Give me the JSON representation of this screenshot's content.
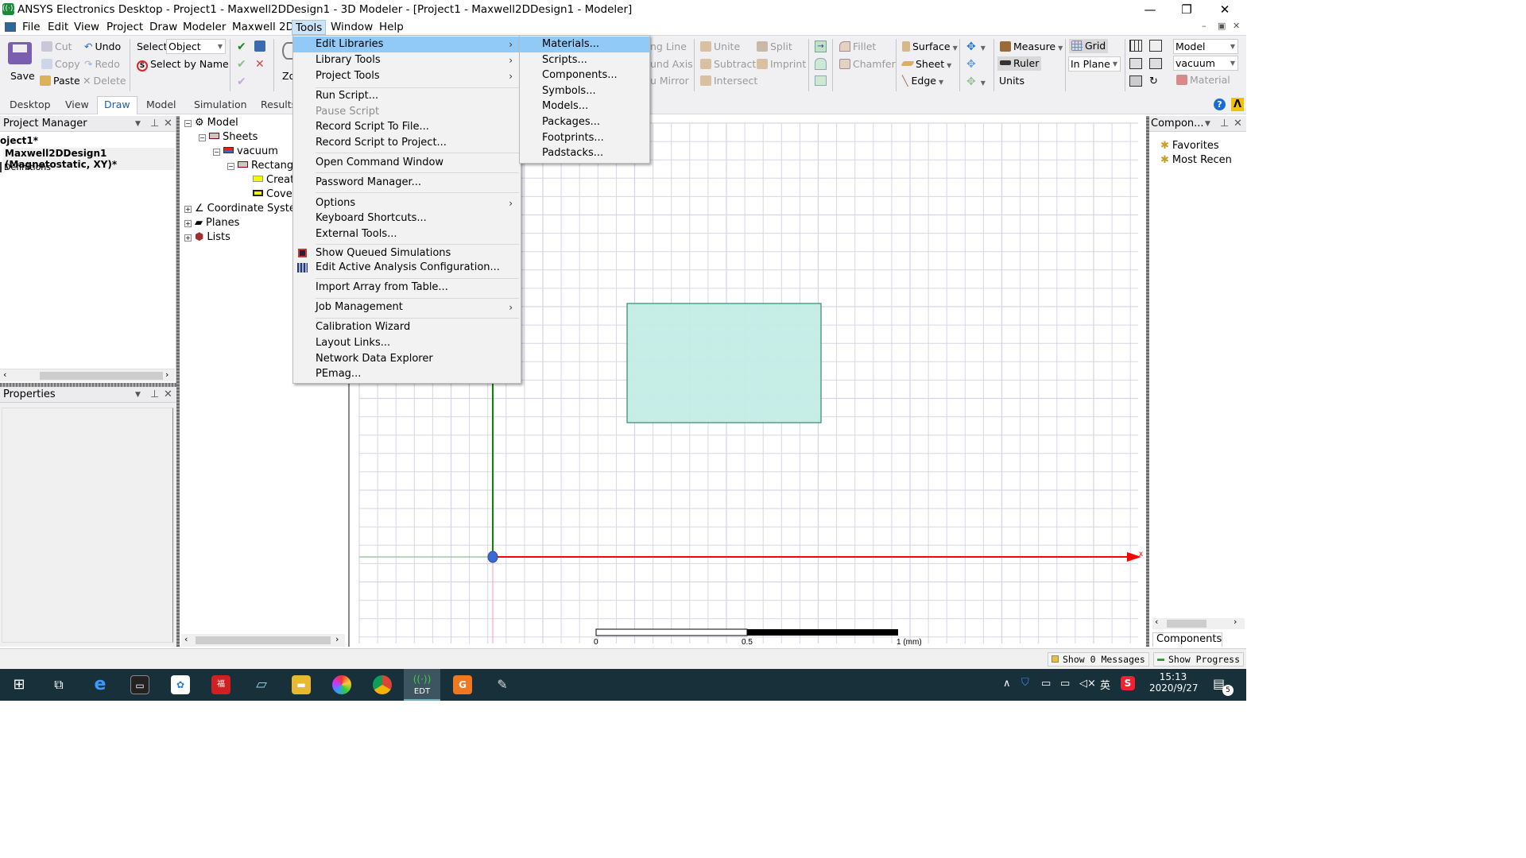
{
  "window": {
    "title": "ANSYS Electronics Desktop - Project1 - Maxwell2DDesign1 - 3D Modeler - [Project1 - Maxwell2DDesign1 - Modeler]",
    "controls": {
      "minimize": "—",
      "restore": "❐",
      "close": "✕"
    },
    "mdi_controls": {
      "minimize": "–",
      "restore": "▣",
      "close": "✕"
    }
  },
  "menubar": {
    "items": [
      "File",
      "Edit",
      "View",
      "Project",
      "Draw",
      "Modeler",
      "Maxwell 2D",
      "Tools",
      "Window",
      "Help"
    ],
    "active": "Tools"
  },
  "ribbon": {
    "save": "Save",
    "cut": "Cut",
    "copy": "Copy",
    "paste": "Paste",
    "undo": "Undo",
    "redo": "Redo",
    "delete": "Delete",
    "select_label": "Select:",
    "select_value": "Object",
    "select_by_name": "Select by Name",
    "zoom_partial": "Zo",
    "along_line": "ng Line",
    "around_axis": "und Axis",
    "thru_mirror": "u Mirror",
    "unite": "Unite",
    "subtract": "Subtract",
    "intersect": "Intersect",
    "split": "Split",
    "imprint": "Imprint",
    "fillet": "Fillet",
    "chamfer": "Chamfer",
    "surface": "Surface",
    "sheet": "Sheet",
    "edge": "Edge",
    "measure": "Measure",
    "ruler": "Ruler",
    "units": "Units",
    "grid": "Grid",
    "grid_plane": "In Plane",
    "model_select": "Model",
    "material_select": "vacuum",
    "material_button": "Material"
  },
  "ribbon_tabs": {
    "items": [
      "Desktop",
      "View",
      "Draw",
      "Model",
      "Simulation",
      "Results"
    ],
    "active": "Draw"
  },
  "project_manager": {
    "title": "Project Manager",
    "project": "oject1*",
    "design": "Maxwell2DDesign1 (Magnetostatic, XY)*",
    "definitions": "Definitions"
  },
  "properties": {
    "title": "Properties"
  },
  "model_tree": {
    "items": [
      {
        "label": "Model",
        "expander": "⊟"
      },
      {
        "label": "Sheets",
        "expander": "⊟"
      },
      {
        "label": "vacuum",
        "expander": "⊟"
      },
      {
        "label": "Rectang",
        "expander": "⊟"
      },
      {
        "label": "Creat",
        "expander": ""
      },
      {
        "label": "Cove",
        "expander": ""
      },
      {
        "label": "Coordinate Syste",
        "expander": "⊞"
      },
      {
        "label": "Planes",
        "expander": "⊞"
      },
      {
        "label": "Lists",
        "expander": "⊞"
      }
    ]
  },
  "tools_menu": {
    "items": [
      {
        "label": "Edit Libraries",
        "submenu": true,
        "highlighted": true
      },
      {
        "label": "Library Tools",
        "submenu": true
      },
      {
        "label": "Project Tools",
        "submenu": true
      },
      {
        "label": "Run Script..."
      },
      {
        "label": "Pause Script",
        "disabled": true
      },
      {
        "label": "Record Script To File..."
      },
      {
        "label": "Record Script to Project..."
      },
      {
        "label": "Open Command Window"
      },
      {
        "label": "Password Manager..."
      },
      {
        "label": "Options",
        "submenu": true
      },
      {
        "label": "Keyboard Shortcuts..."
      },
      {
        "label": "External Tools..."
      },
      {
        "label": "Show Queued Simulations"
      },
      {
        "label": "Edit Active Analysis Configuration..."
      },
      {
        "label": "Import Array from Table..."
      },
      {
        "label": "Job Management",
        "submenu": true
      },
      {
        "label": "Calibration Wizard"
      },
      {
        "label": "Layout Links..."
      },
      {
        "label": "Network Data Explorer"
      },
      {
        "label": "PEmag..."
      }
    ],
    "submenu_arrow": "›"
  },
  "edit_libraries_submenu": {
    "items": [
      "Materials...",
      "Scripts...",
      "Components...",
      "Symbols...",
      "Models...",
      "Packages...",
      "Footprints...",
      "Padstacks..."
    ],
    "highlighted": "Materials..."
  },
  "components_panel": {
    "title": "Compon...",
    "items": [
      "Favorites",
      "Most Recen"
    ],
    "tab": "Components"
  },
  "viewport": {
    "ruler_labels": [
      "0",
      "0.5",
      "1 (mm)"
    ],
    "axis_x_label": "x",
    "colors": {
      "x_axis": "#ff0000",
      "y_axis": "#008c00",
      "rectangle_fill": "#c4ece6",
      "rectangle_stroke": "#2f8a72",
      "grid": "#d8d6e6"
    }
  },
  "statusbar": {
    "messages": "Show 0 Messages",
    "progress": "Show Progress"
  },
  "taskbar": {
    "tray_ime": "英",
    "time": "15:13",
    "date": "2020/9/27",
    "notifications": "5",
    "edt_label": "EDT"
  }
}
